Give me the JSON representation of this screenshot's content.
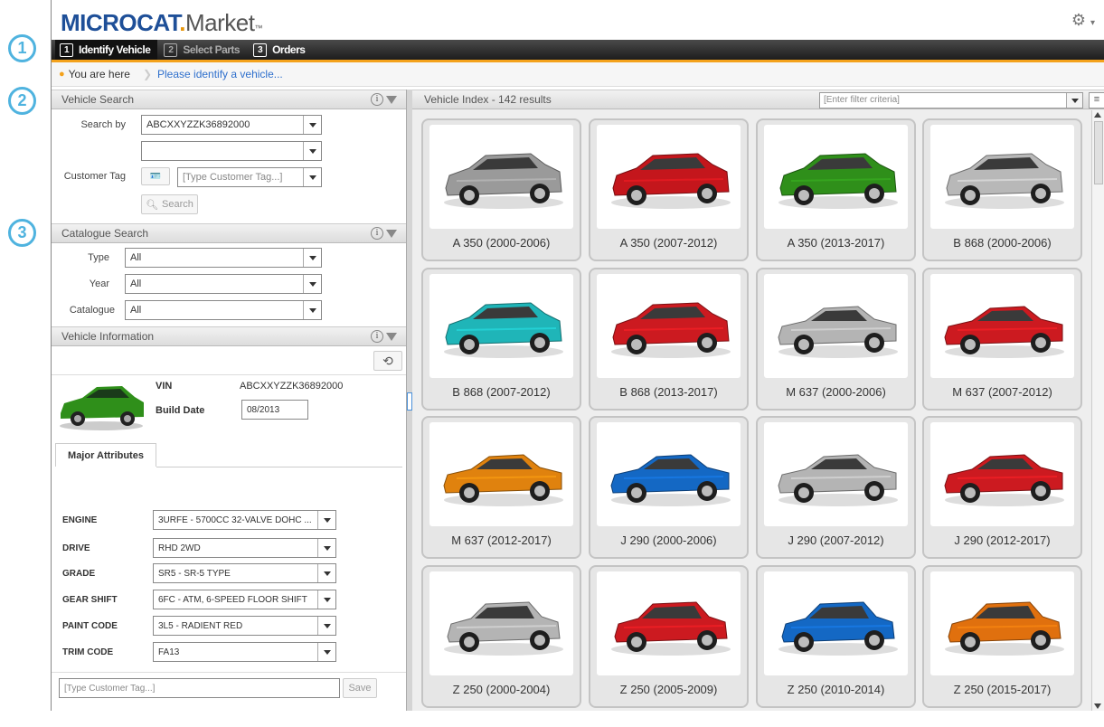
{
  "annotations": [
    "1",
    "2",
    "3"
  ],
  "app": {
    "logo_brand": "MICROCAT",
    "logo_dot": ".",
    "logo_market": "Market",
    "logo_tm": "™",
    "settings_icon": "gear-icon"
  },
  "nav": {
    "steps": [
      {
        "num": "1",
        "label": "Identify Vehicle",
        "active": true
      },
      {
        "num": "2",
        "label": "Select Parts",
        "active": false
      },
      {
        "num": "3",
        "label": "Orders",
        "active": false
      }
    ]
  },
  "breadcrumb": {
    "here": "You are here",
    "link": "Please identify a vehicle..."
  },
  "vehicle_search": {
    "title": "Vehicle Search",
    "search_by_label": "Search by",
    "search_by_value": "ABCXXYZZK36892000",
    "second_value": "",
    "customer_tag_label": "Customer Tag",
    "customer_tag_placeholder": "[Type Customer Tag...]",
    "search_button": "Search"
  },
  "catalogue_search": {
    "title": "Catalogue Search",
    "fields": [
      {
        "label": "Type",
        "value": "All"
      },
      {
        "label": "Year",
        "value": "All"
      },
      {
        "label": "Catalogue",
        "value": "All"
      }
    ]
  },
  "vehicle_info": {
    "title": "Vehicle Information",
    "vin_label": "VIN",
    "vin_value": "ABCXXYZZK36892000",
    "build_label": "Build Date",
    "build_value": "08/2013",
    "tab_label": "Major Attributes",
    "attributes": [
      {
        "label": "ENGINE",
        "value": "3URFE - 5700CC 32-VALVE DOHC ..."
      },
      {
        "label": "DRIVE",
        "value": "RHD 2WD"
      },
      {
        "label": "GRADE",
        "value": "SR5 - SR-5 TYPE"
      },
      {
        "label": "GEAR SHIFT",
        "value": "6FC - ATM, 6-SPEED FLOOR SHIFT"
      },
      {
        "label": "PAINT CODE",
        "value": "3L5 - RADIENT RED"
      },
      {
        "label": "TRIM CODE",
        "value": "FA13"
      }
    ],
    "tag_placeholder": "[Type Customer Tag...]",
    "save_button": "Save"
  },
  "vehicle_index": {
    "title": "Vehicle Index - 142 results",
    "filter_placeholder": "[Enter filter criteria]",
    "vehicles": [
      {
        "label": "A 350 (2000-2006)",
        "color": "#9a9a9a",
        "type": "wagon"
      },
      {
        "label": "A 350 (2007-2012)",
        "color": "#c4161c",
        "type": "wagon"
      },
      {
        "label": "A 350 (2013-2017)",
        "color": "#2f8f1a",
        "type": "wagon"
      },
      {
        "label": "B 868 (2000-2006)",
        "color": "#b8b8b8",
        "type": "wagon"
      },
      {
        "label": "B 868 (2007-2012)",
        "color": "#1fb5b8",
        "type": "wagon"
      },
      {
        "label": "B 868 (2013-2017)",
        "color": "#cc1a20",
        "type": "wagon"
      },
      {
        "label": "M 637 (2000-2006)",
        "color": "#b4b4b4",
        "type": "sedan"
      },
      {
        "label": "M 637 (2007-2012)",
        "color": "#cc1a20",
        "type": "sedan"
      },
      {
        "label": "M 637 (2012-2017)",
        "color": "#e0820e",
        "type": "sedan"
      },
      {
        "label": "J 290 (2000-2006)",
        "color": "#1468c4",
        "type": "sedan"
      },
      {
        "label": "J 290 (2007-2012)",
        "color": "#b4b4b4",
        "type": "sedan"
      },
      {
        "label": "J 290 (2012-2017)",
        "color": "#cc1a20",
        "type": "sedan"
      },
      {
        "label": "Z 250 (2000-2004)",
        "color": "#b4b4b4",
        "type": "hatch"
      },
      {
        "label": "Z 250 (2005-2009)",
        "color": "#cc1a20",
        "type": "hatch"
      },
      {
        "label": "Z 250 (2010-2014)",
        "color": "#1468c4",
        "type": "hatch"
      },
      {
        "label": "Z 250 (2015-2017)",
        "color": "#e0700e",
        "type": "hatch"
      }
    ]
  },
  "colors": {
    "accent": "#f4a21c",
    "brand": "#1e4f98",
    "annotation": "#4fb3df",
    "link": "#2e6fcc"
  }
}
